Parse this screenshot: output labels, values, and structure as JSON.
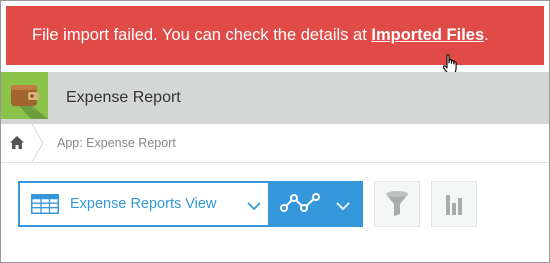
{
  "banner": {
    "message": "File import failed. You can check the details at ",
    "link_text": "Imported Files",
    "suffix": ".",
    "color": "#e04b47"
  },
  "app": {
    "title": "Expense Report",
    "icon": "wallet-icon",
    "icon_color": "#8bc34a"
  },
  "breadcrumb": {
    "home_icon": "home-icon",
    "current": "App: Expense Report"
  },
  "view_selector": {
    "selected": "Expense Reports View",
    "icon": "table-icon",
    "accent": "#3498db"
  },
  "toolbar": {
    "graph_icon": "graph-icon",
    "filter_icon": "filter-icon",
    "chart_icon": "bar-chart-icon"
  }
}
